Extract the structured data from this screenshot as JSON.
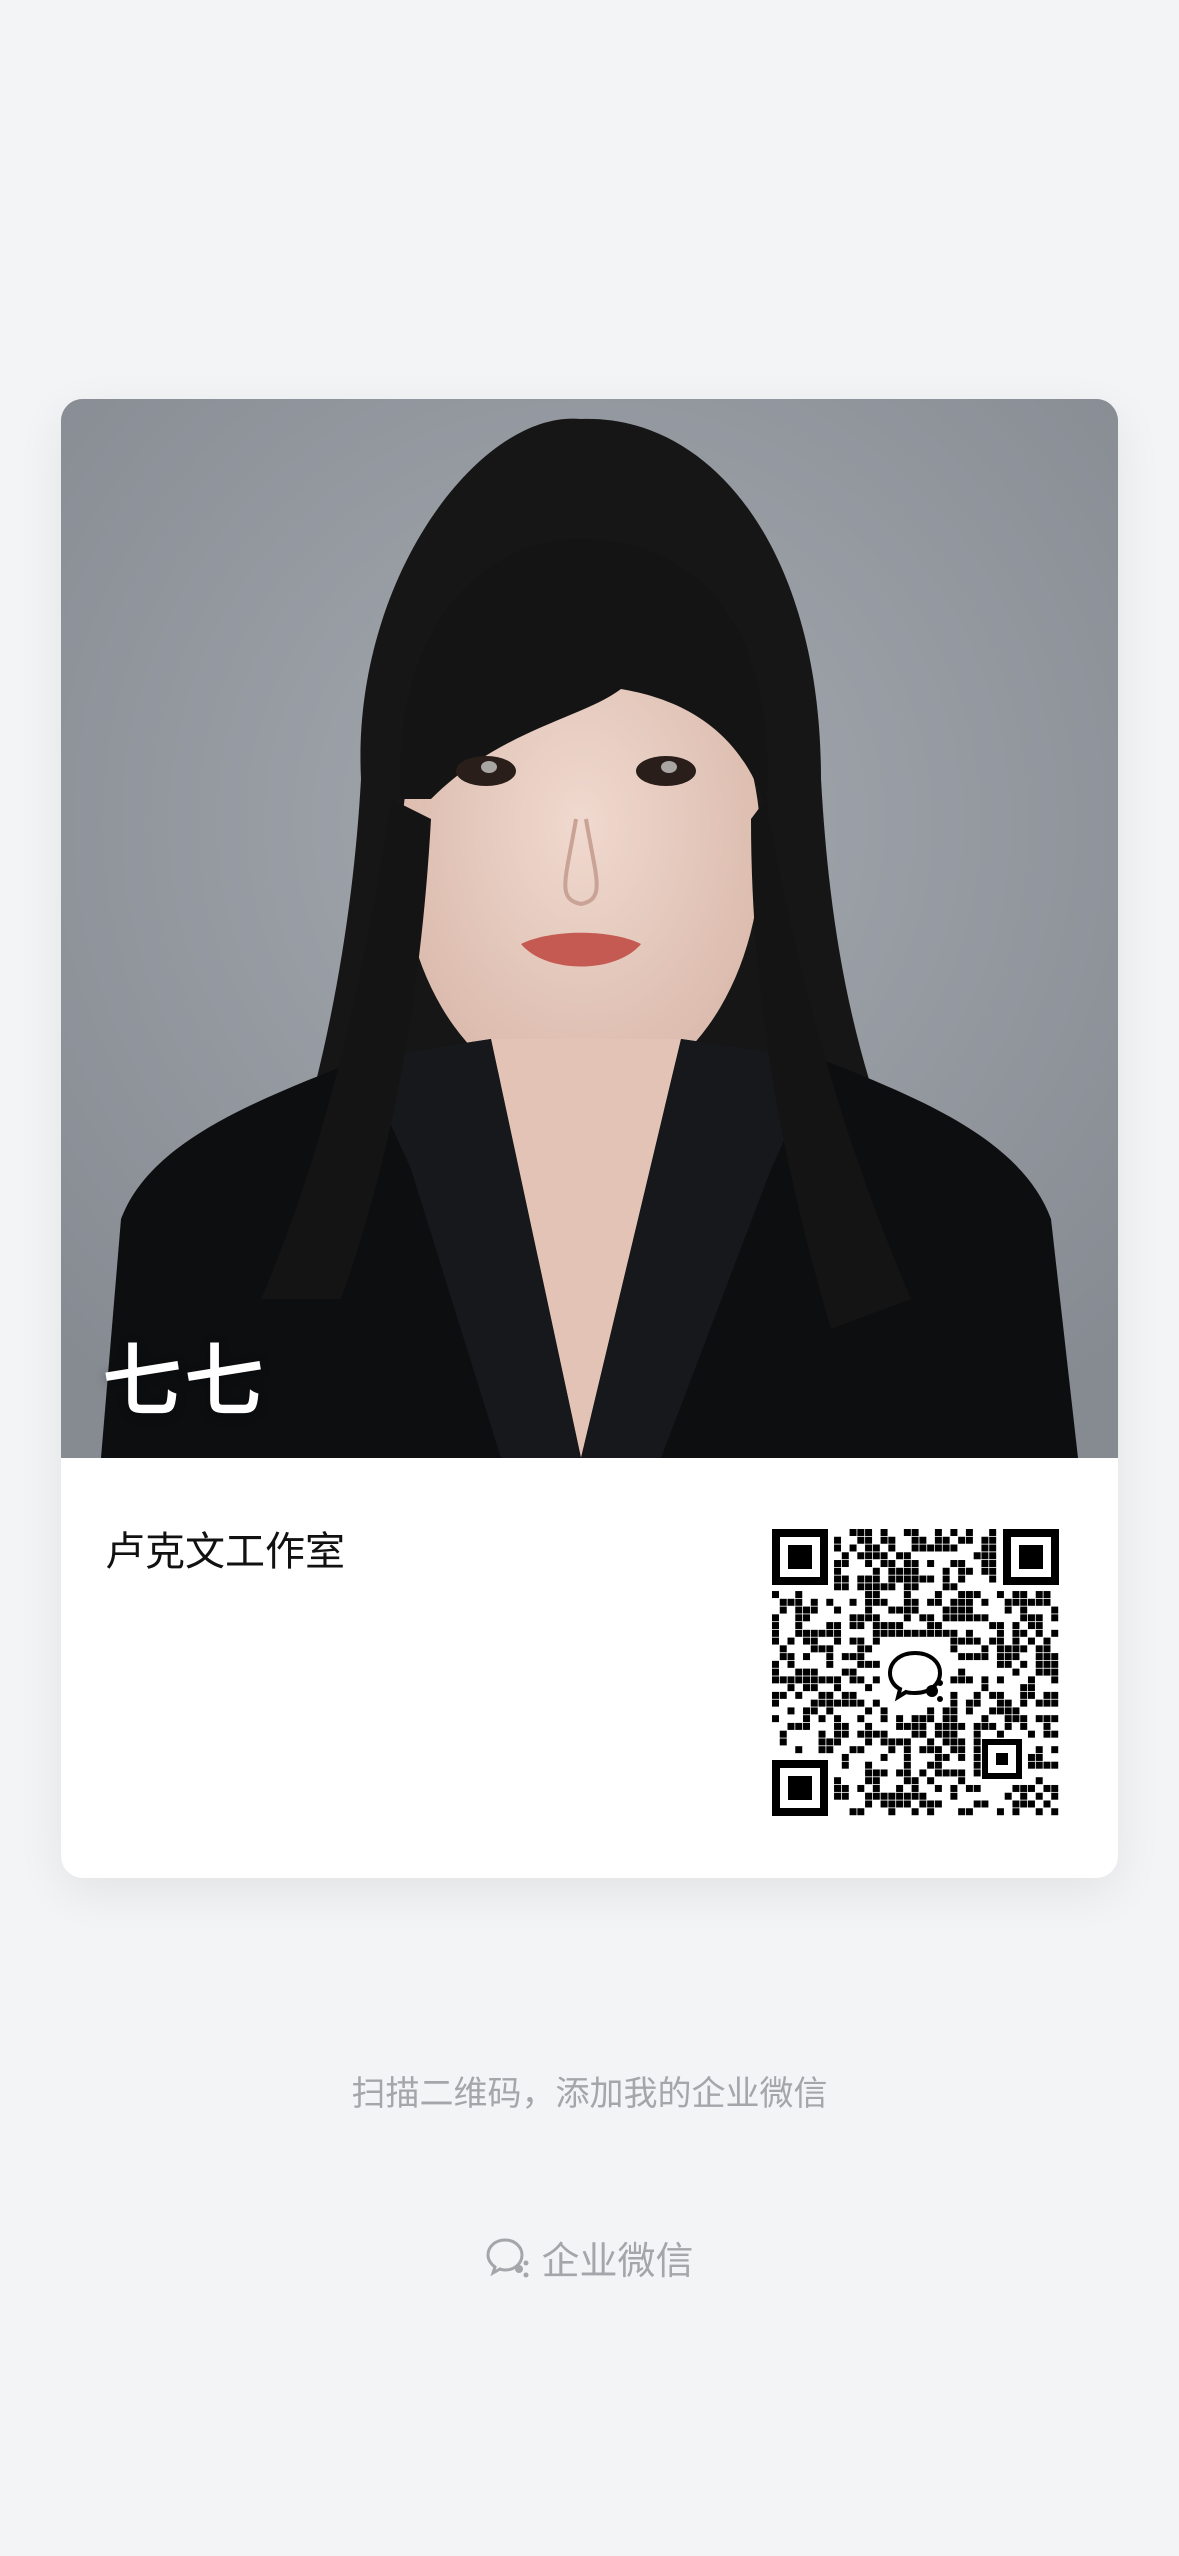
{
  "card": {
    "name": "七七",
    "company": "卢克文工作室"
  },
  "qr": {
    "center_icon": "wecom-logo-icon"
  },
  "footer": {
    "hint": "扫描二维码，添加我的企业微信",
    "brand_label": "企业微信",
    "brand_icon": "wecom-logo-icon"
  },
  "colors": {
    "background": "#f3f4f6",
    "card": "#ffffff",
    "muted_text": "#a4a6aa"
  }
}
